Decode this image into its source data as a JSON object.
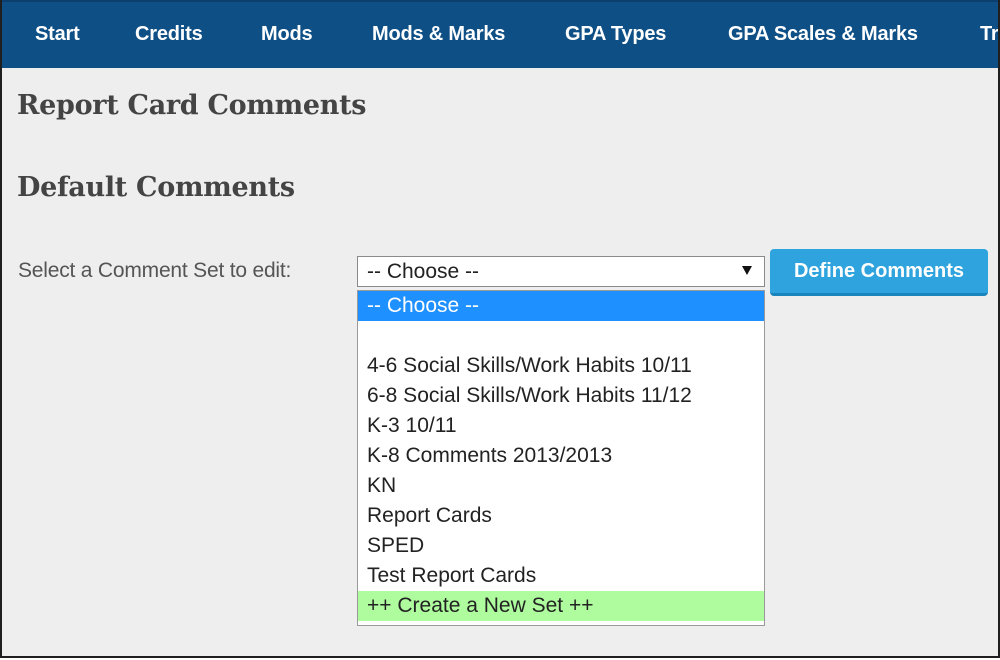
{
  "nav": {
    "items": [
      {
        "label": "Start"
      },
      {
        "label": "Credits"
      },
      {
        "label": "Mods"
      },
      {
        "label": "Mods & Marks"
      },
      {
        "label": "GPA Types"
      },
      {
        "label": "GPA Scales & Marks"
      },
      {
        "label": "Tr"
      }
    ]
  },
  "page": {
    "title": "Report Card Comments",
    "section_title": "Default Comments"
  },
  "comment_set_select": {
    "label": "Select a Comment Set to edit:",
    "value": "-- Choose --"
  },
  "define_button": {
    "label": "Define Comments"
  },
  "dropdown": {
    "options": [
      {
        "label": "-- Choose --",
        "state": "highlighted"
      },
      {
        "label": ""
      },
      {
        "label": "4-6 Social Skills/Work Habits 10/11"
      },
      {
        "label": "6-8 Social Skills/Work Habits 11/12"
      },
      {
        "label": "K-3 10/11"
      },
      {
        "label": "K-8 Comments 2013/2013"
      },
      {
        "label": "KN"
      },
      {
        "label": "Report Cards"
      },
      {
        "label": "SPED"
      },
      {
        "label": "Test Report Cards"
      },
      {
        "label": "++ Create a New Set ++",
        "state": "create"
      }
    ]
  },
  "colors": {
    "nav_background": "#0e4f86",
    "highlight": "#1e90ff",
    "create_option": "#aefc9e",
    "button": "#2ea3de"
  }
}
